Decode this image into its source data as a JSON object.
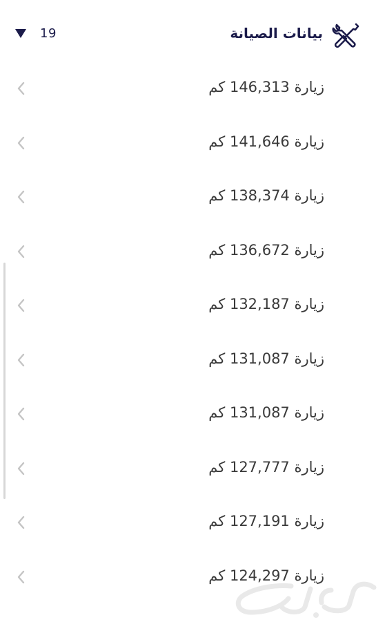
{
  "header": {
    "title": "بيانات الصيانة",
    "count": "19",
    "icon": "tools-icon"
  },
  "visits": [
    {
      "label": "زيارة 146,313 كم"
    },
    {
      "label": "زيارة 141,646 كم"
    },
    {
      "label": "زيارة 138,374 كم"
    },
    {
      "label": "زيارة 136,672 كم"
    },
    {
      "label": "زيارة 132,187 كم"
    },
    {
      "label": "زيارة 131,087 كم"
    },
    {
      "label": "زيارة 131,087 كم"
    },
    {
      "label": "زيارة 127,777 كم"
    },
    {
      "label": "زيارة 127,191 كم"
    },
    {
      "label": "زيارة 124,297 كم"
    }
  ],
  "watermark": {
    "text": "حراج"
  },
  "colors": {
    "header_text": "#1b1b4a",
    "row_text": "#3a3a3a",
    "chevron": "#c4c4c4"
  }
}
